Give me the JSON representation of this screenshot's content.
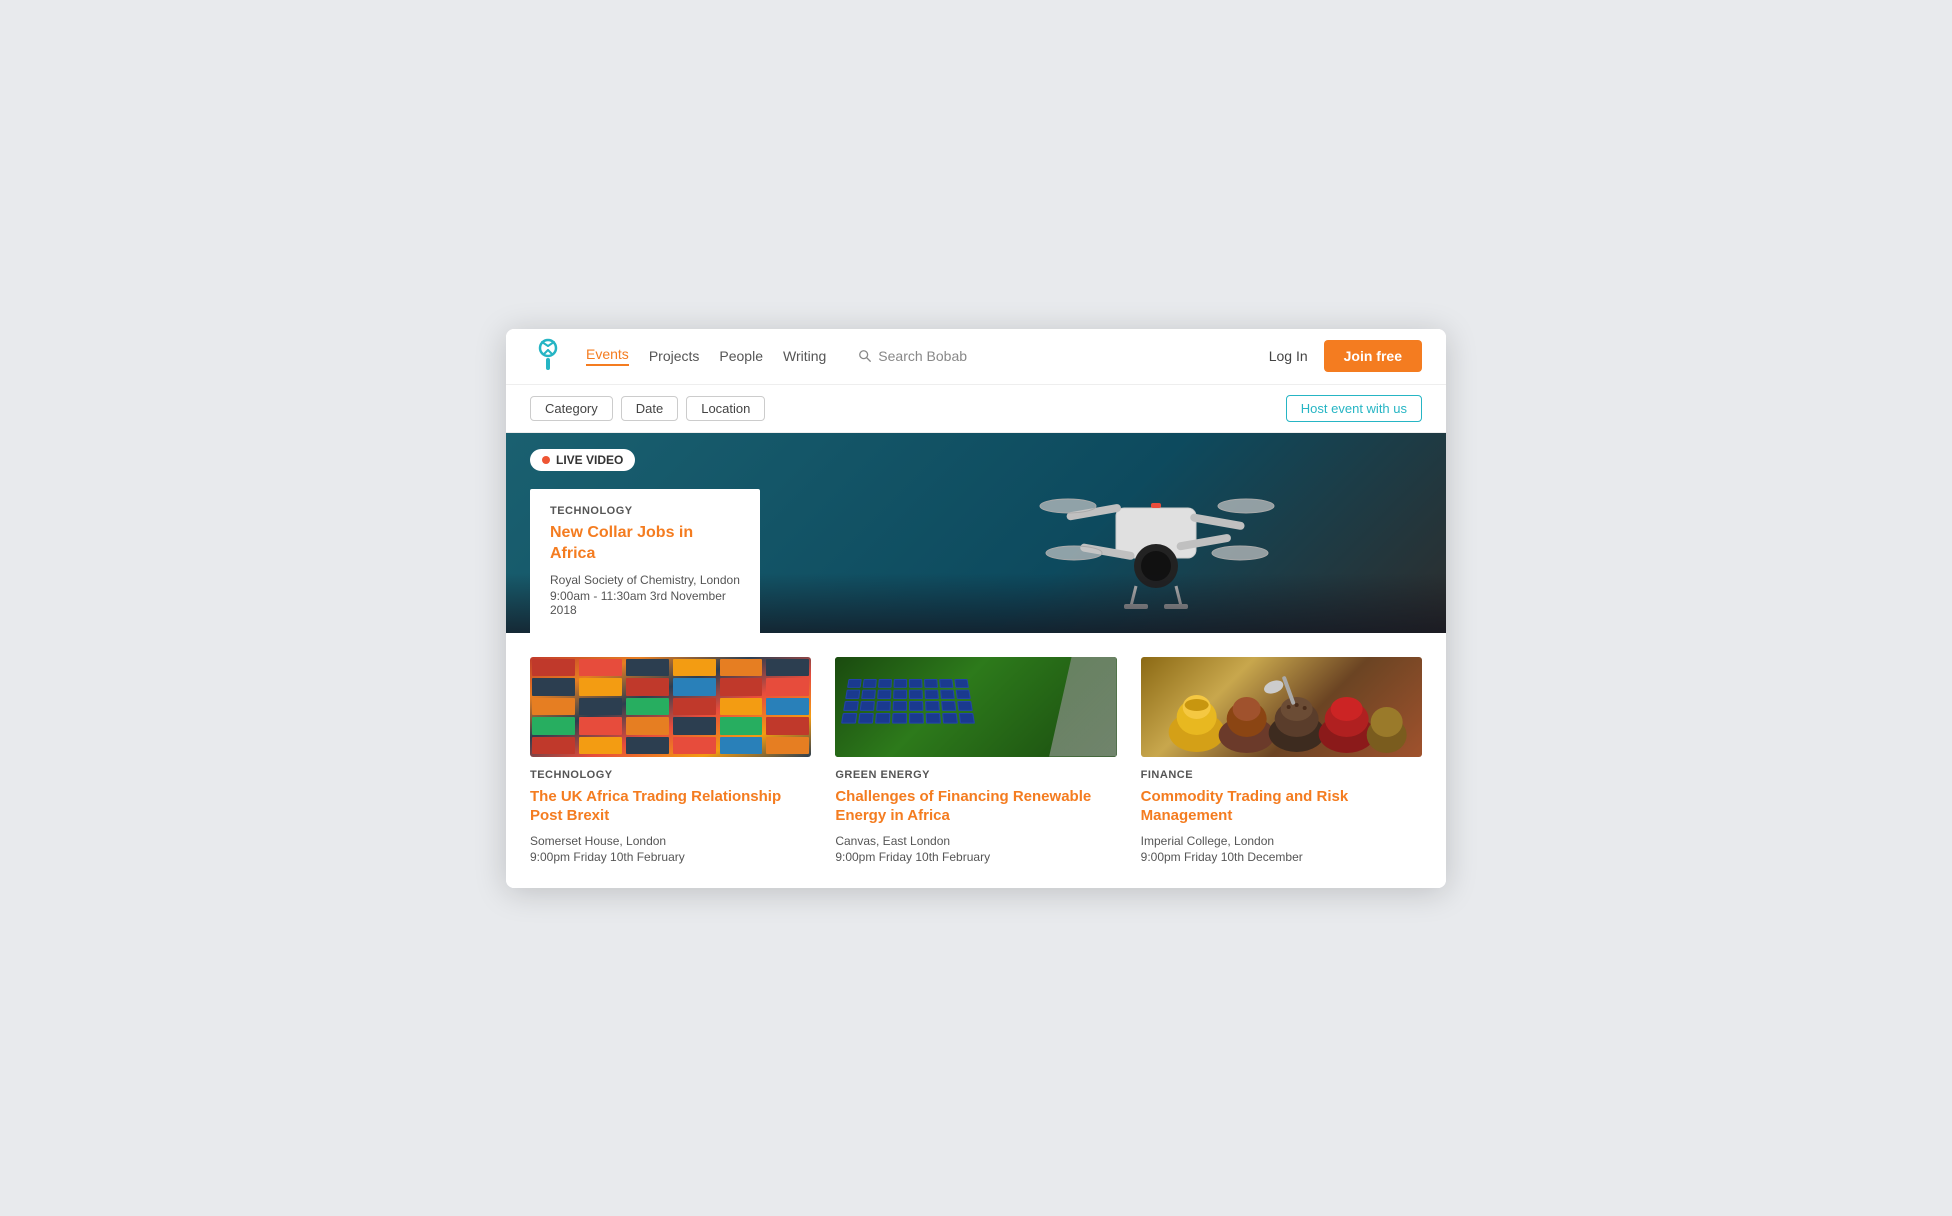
{
  "site": {
    "logo_alt": "Bobab Logo"
  },
  "navbar": {
    "links": [
      {
        "label": "Events",
        "active": true
      },
      {
        "label": "Projects",
        "active": false
      },
      {
        "label": "People",
        "active": false
      },
      {
        "label": "Writing",
        "active": false
      }
    ],
    "search_placeholder": "Search Bobab",
    "login_label": "Log In",
    "join_label": "Join free"
  },
  "filter_bar": {
    "category_label": "Category",
    "date_label": "Date",
    "location_label": "Location",
    "host_label": "Host event with us"
  },
  "hero": {
    "live_badge": "LIVE VIDEO",
    "card": {
      "category": "TECHNOLOGY",
      "title": "New Collar Jobs in Africa",
      "venue": "Royal Society of Chemistry, London",
      "time": "9:00am - 11:30am 3rd November 2018"
    }
  },
  "events": [
    {
      "category": "TECHNOLOGY",
      "title": "The UK Africa Trading Relationship Post Brexit",
      "venue": "Somerset House, London",
      "time": "9:00pm Friday 10th February",
      "img_type": "shipping"
    },
    {
      "category": "GREEN ENERGY",
      "title": "Challenges of Financing Renewable Energy in Africa",
      "venue": "Canvas, East London",
      "time": "9:00pm Friday 10th February",
      "img_type": "solar"
    },
    {
      "category": "FINANCE",
      "title": "Commodity Trading and Risk Management",
      "venue": "Imperial College, London",
      "time": "9:00pm Friday 10th December",
      "img_type": "spices"
    }
  ]
}
